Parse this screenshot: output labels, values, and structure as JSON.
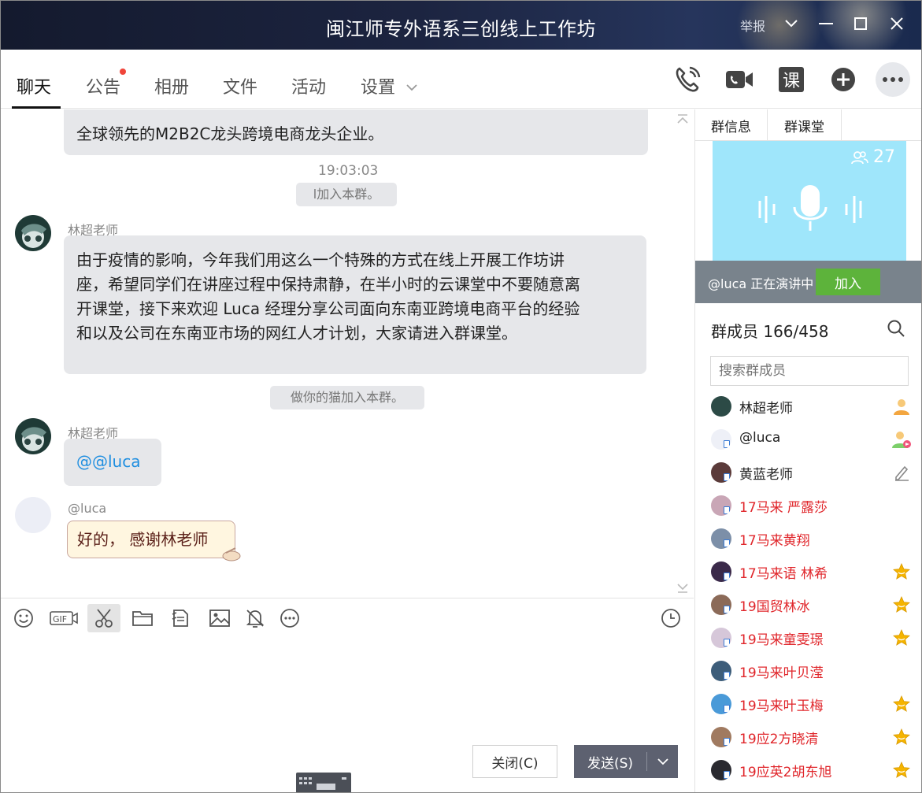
{
  "window": {
    "title": "闽江师专外语系三创线上工作坊",
    "report": "举报"
  },
  "tabs": [
    {
      "label": "聊天",
      "active": true
    },
    {
      "label": "公告",
      "badge_dot": true
    },
    {
      "label": "相册"
    },
    {
      "label": "文件"
    },
    {
      "label": "活动"
    },
    {
      "label": "设置"
    }
  ],
  "tools": {
    "course_label": "课"
  },
  "chat": {
    "messages": [
      {
        "type": "partial",
        "text": "全球领先的M2B2C龙头跨境电商龙头企业。"
      },
      {
        "type": "time",
        "text": "19:03:03"
      },
      {
        "type": "system",
        "text": "l加入本群。"
      },
      {
        "type": "message",
        "sender": "林超老师",
        "lines": [
          "由于疫情的影响，今年我们用这么一个特殊的方式在线上开展工作坊讲",
          "座，希望同学们在讲座过程中保持肃静，在半小时的云课堂中不要随意离",
          "开课堂，接下来欢迎 Luca 经理分享公司面向东南亚跨境电商平台的经验",
          "和以及公司在东南亚市场的网红人才计划，大家请进入群课堂。"
        ]
      },
      {
        "type": "system",
        "text": "做你的猫加入本群。"
      },
      {
        "type": "message",
        "sender": "林超老师",
        "text": "@@luca",
        "color": "#1e8ee0"
      },
      {
        "type": "message",
        "sender": "@luca",
        "text": "好的， 感谢林老师",
        "style": "bubble-cream"
      }
    ]
  },
  "composer": {
    "close_label": "关闭(C)",
    "send_label": "发送(S)"
  },
  "panel": {
    "tabs": [
      "群信息",
      "群课堂"
    ],
    "classroom": {
      "count": "27",
      "speaker_text": "@luca 正在演讲中",
      "join_label": "加入"
    },
    "members_title": "群成员 166/458",
    "search_placeholder": "搜索群成员",
    "members": [
      {
        "name": "林超老师",
        "red": false,
        "badge": "owner-icon"
      },
      {
        "name": "@luca",
        "red": false,
        "badge": "presenter-icon"
      },
      {
        "name": "黄蓝老师",
        "red": false,
        "badge": "pencil-icon"
      },
      {
        "name": "17马来 严露莎",
        "red": true,
        "badge": ""
      },
      {
        "name": "17马来黄翔",
        "red": true,
        "badge": ""
      },
      {
        "name": "17马来语 林希",
        "red": true,
        "badge": "star-icon"
      },
      {
        "name": "19国贸林冰",
        "red": true,
        "badge": "star-icon"
      },
      {
        "name": "19马来童雯璟",
        "red": true,
        "badge": "star-icon"
      },
      {
        "name": "19马来叶贝滢",
        "red": true,
        "badge": ""
      },
      {
        "name": "19马来叶玉梅",
        "red": true,
        "badge": "star-icon"
      },
      {
        "name": "19应2方晓清",
        "red": true,
        "badge": "star-icon"
      },
      {
        "name": "19应英2胡东旭",
        "red": true,
        "badge": "star-icon"
      }
    ]
  },
  "colors": {
    "bubble": "#e6e7ea",
    "link": "#1e8ee0",
    "member_red": "#e0262b",
    "join_green": "#5db33b",
    "star": "#f5b400"
  }
}
